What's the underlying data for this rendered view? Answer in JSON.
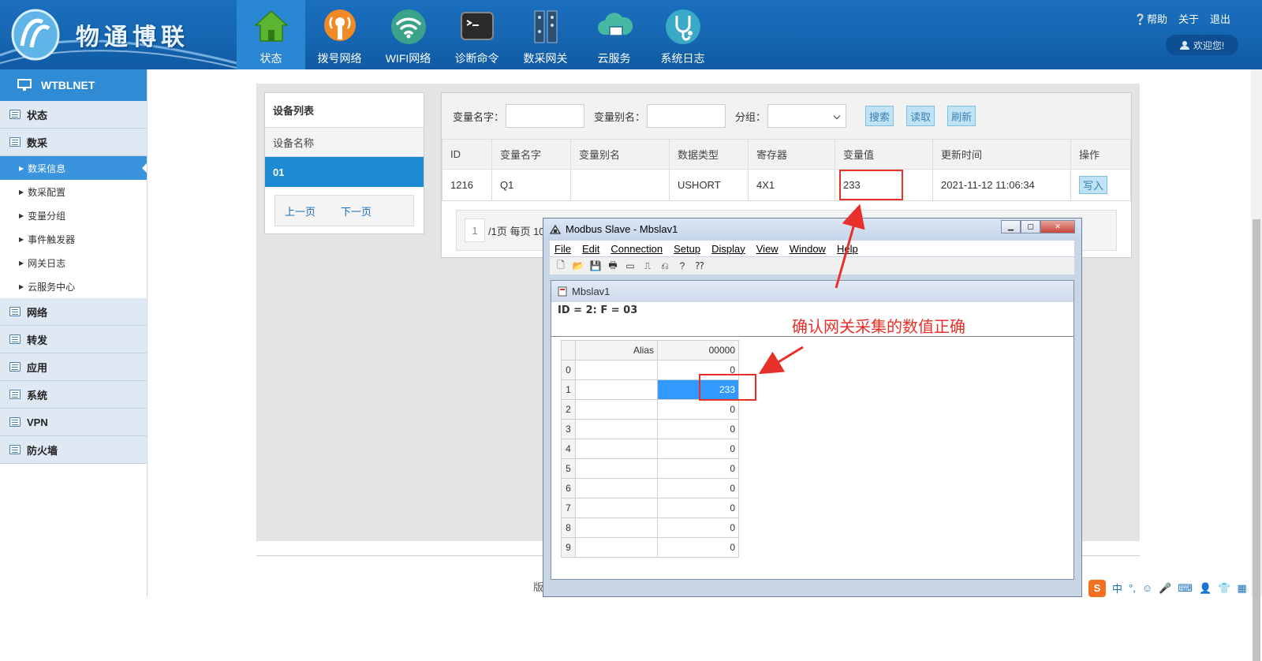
{
  "header": {
    "brand": "物通博联",
    "nav": [
      {
        "label": "状态",
        "icon": "home-icon"
      },
      {
        "label": "拨号网络",
        "icon": "antenna-icon"
      },
      {
        "label": "WIFI网络",
        "icon": "wifi-icon"
      },
      {
        "label": "诊断命令",
        "icon": "terminal-icon"
      },
      {
        "label": "数采网关",
        "icon": "gateway-icon"
      },
      {
        "label": "云服务",
        "icon": "cloud-icon"
      },
      {
        "label": "系统日志",
        "icon": "stethoscope-icon"
      }
    ],
    "help": "帮助",
    "about": "关于",
    "logout": "退出",
    "welcome": "欢迎您!"
  },
  "sidebar": {
    "title": "WTBLNET",
    "groups": [
      {
        "label": "状态"
      },
      {
        "label": "数采"
      },
      {
        "label": "网络"
      },
      {
        "label": "转发"
      },
      {
        "label": "应用"
      },
      {
        "label": "系统"
      },
      {
        "label": "VPN"
      },
      {
        "label": "防火墙"
      }
    ],
    "subitems": [
      "数采信息",
      "数采配置",
      "变量分组",
      "事件触发器",
      "网关日志",
      "云服务中心"
    ]
  },
  "device_panel": {
    "title": "设备列表",
    "column": "设备名称",
    "row": "01",
    "prev": "上一页",
    "next": "下一页"
  },
  "filter": {
    "name_label": "变量名字：",
    "alias_label": "变量别名：",
    "group_label": "分组：",
    "search": "搜索",
    "read": "读取",
    "refresh": "刷新"
  },
  "table": {
    "headers": [
      "ID",
      "变量名字",
      "变量别名",
      "数据类型",
      "寄存器",
      "变量值",
      "更新时间",
      "操作"
    ],
    "rows": [
      {
        "id": "1216",
        "name": "Q1",
        "alias": "",
        "type": "USHORT",
        "register": "4X1",
        "value": "233",
        "time": "2021-11-12 11:06:34",
        "action": "写入"
      }
    ]
  },
  "pager": {
    "page": "1",
    "text": "/1页 每页 10"
  },
  "footer": {
    "text": "版"
  },
  "modbus": {
    "title": "Modbus Slave - Mbslav1",
    "menu": [
      "File",
      "Edit",
      "Connection",
      "Setup",
      "Display",
      "View",
      "Window",
      "Help"
    ],
    "child_title": "Mbslav1",
    "id_line": "ID = 2: F = 03",
    "col_alias": "Alias",
    "col_addr": "00000",
    "rows": [
      {
        "r": "0",
        "v": "0"
      },
      {
        "r": "1",
        "v": "233"
      },
      {
        "r": "2",
        "v": "0"
      },
      {
        "r": "3",
        "v": "0"
      },
      {
        "r": "4",
        "v": "0"
      },
      {
        "r": "5",
        "v": "0"
      },
      {
        "r": "6",
        "v": "0"
      },
      {
        "r": "7",
        "v": "0"
      },
      {
        "r": "8",
        "v": "0"
      },
      {
        "r": "9",
        "v": "0"
      }
    ]
  },
  "annotation": "确认网关采集的数值正确",
  "tray": {
    "ime": "中"
  },
  "colors": {
    "header_blue": "#1565b0",
    "active_blue": "#1c8bd2",
    "annotation_red": "#e8302a"
  }
}
